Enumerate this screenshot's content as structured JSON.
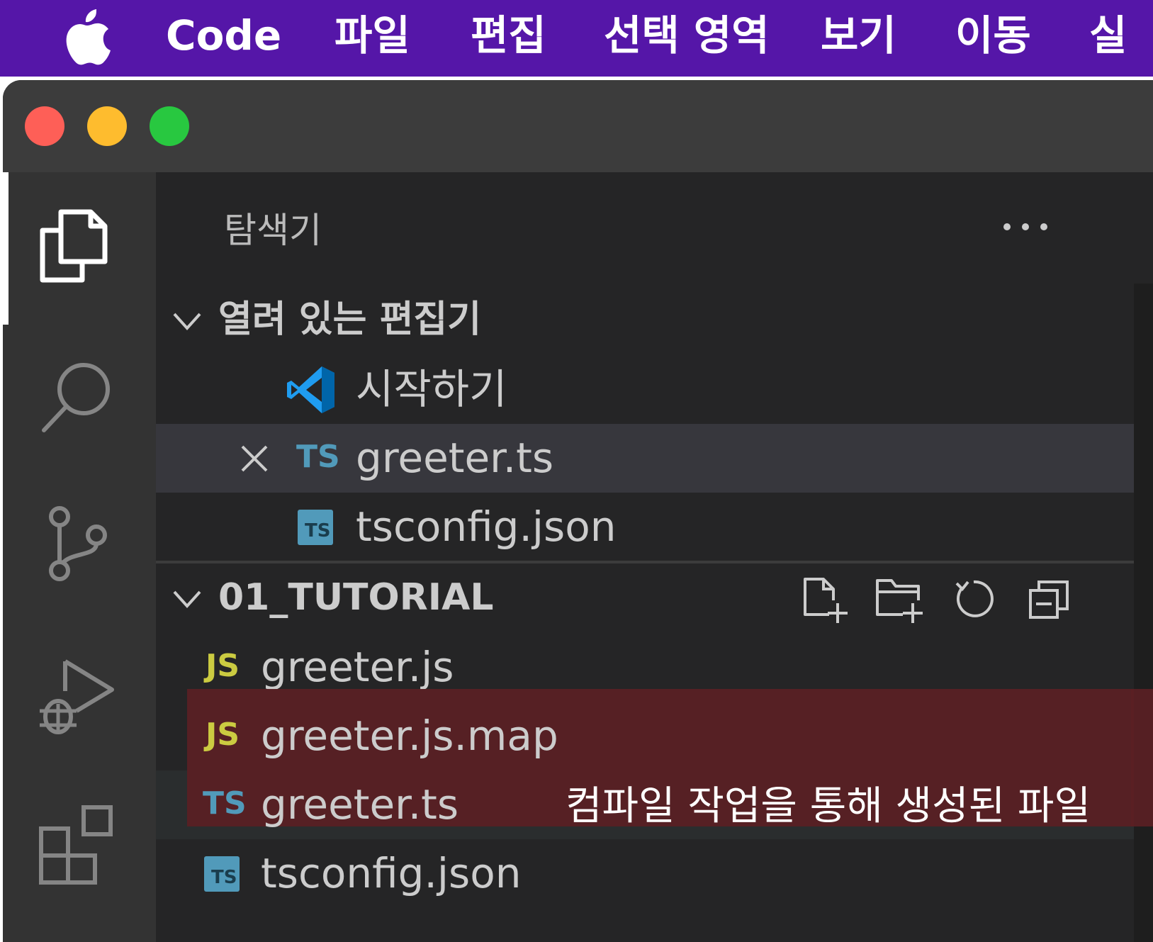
{
  "menubar": {
    "items": [
      "Code",
      "파일",
      "편집",
      "선택 영역",
      "보기",
      "이동",
      "실"
    ]
  },
  "explorer": {
    "title": "탐색기"
  },
  "open_editors": {
    "title": "열려 있는 편집기",
    "items": [
      {
        "label": "시작하기",
        "icon": "vscode-logo-icon"
      },
      {
        "label": "greeter.ts",
        "icon": "TS"
      },
      {
        "label": "tsconfig.json",
        "icon": "TS"
      }
    ]
  },
  "folder": {
    "title": "01_TUTORIAL",
    "files": [
      {
        "label": "greeter.js",
        "icon": "JS"
      },
      {
        "label": "greeter.js.map",
        "icon": "JS"
      },
      {
        "label": "greeter.ts",
        "icon": "TS"
      },
      {
        "label": "tsconfig.json",
        "icon": "TS"
      }
    ]
  },
  "annotation": "컴파일 작업을 통해 생성된 파일",
  "colors": {
    "menubar": "#5516a8",
    "js_icon": "#cbcb41",
    "ts_icon": "#519aba",
    "highlight": "#5a1f24"
  }
}
